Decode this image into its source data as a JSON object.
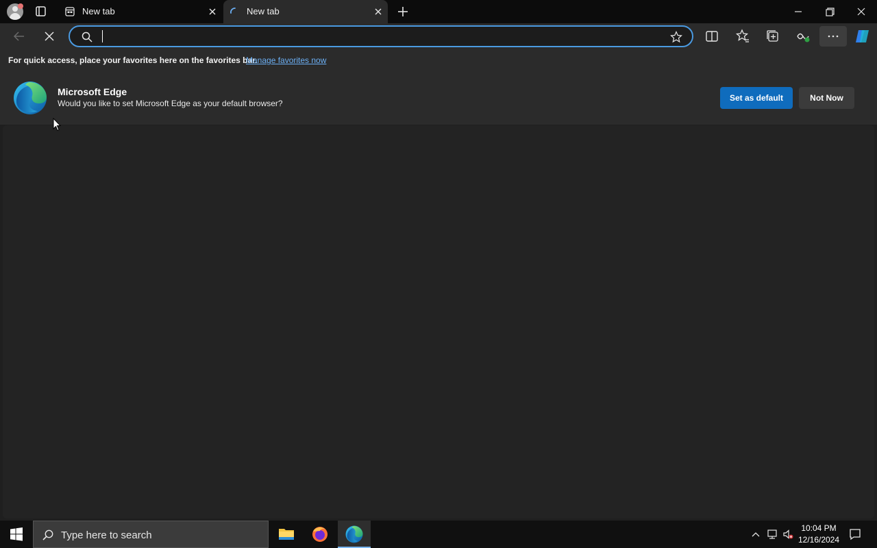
{
  "tabs": [
    {
      "title": "New tab"
    },
    {
      "title": "New tab"
    }
  ],
  "address_bar": {
    "value": "",
    "placeholder": ""
  },
  "favorites_bar": {
    "message": "For quick access, place your favorites here on the favorites bar.",
    "link": "Manage favorites now"
  },
  "infobar": {
    "title": "Microsoft Edge",
    "message": "Would you like to set Microsoft Edge as your default browser?",
    "primary_button": "Set as default",
    "secondary_button": "Not Now"
  },
  "taskbar": {
    "search_placeholder": "Type here to search",
    "time": "10:04 PM",
    "date": "12/16/2024"
  },
  "colors": {
    "accent": "#0f6cbd",
    "focus_ring": "#4a9ae1",
    "link": "#6cb0f5"
  }
}
